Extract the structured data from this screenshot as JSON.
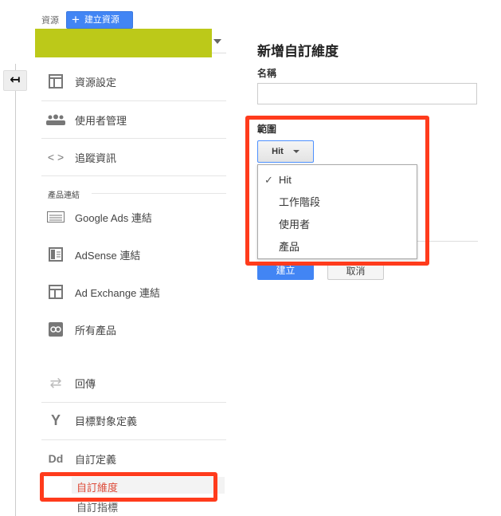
{
  "header": {
    "property_label": "資源",
    "create_button": "建立資源"
  },
  "sidebar": {
    "items": [
      {
        "label": "資源設定",
        "icon": "layout-icon"
      },
      {
        "label": "使用者管理",
        "icon": "people-icon"
      },
      {
        "label": "追蹤資訊",
        "icon": "code-icon"
      }
    ],
    "section_label": "產品連結",
    "product_links": [
      {
        "label": "Google Ads 連結",
        "icon": "ads-icon"
      },
      {
        "label": "AdSense 連結",
        "icon": "adsense-icon"
      },
      {
        "label": "Ad Exchange 連結",
        "icon": "adexchange-icon"
      },
      {
        "label": "所有產品",
        "icon": "link-icon"
      }
    ],
    "more": [
      {
        "label": "回傳",
        "icon": "postback-icon"
      },
      {
        "label": "目標對象定義",
        "icon": "audience-icon"
      },
      {
        "label": "自訂定義",
        "icon": "Dd"
      }
    ],
    "sub_items": [
      {
        "label": "自訂維度",
        "active": true
      },
      {
        "label": "自訂指標"
      }
    ]
  },
  "form": {
    "title": "新增自訂維度",
    "name_label": "名稱",
    "name_value": "",
    "scope_label": "範圍",
    "scope_selected": "Hit",
    "scope_options": [
      "Hit",
      "工作階段",
      "使用者",
      "產品"
    ],
    "create": "建立",
    "cancel": "取消"
  },
  "colors": {
    "accent": "#4285f4",
    "active": "#dd4b39",
    "annotation": "#ff3b1c"
  }
}
